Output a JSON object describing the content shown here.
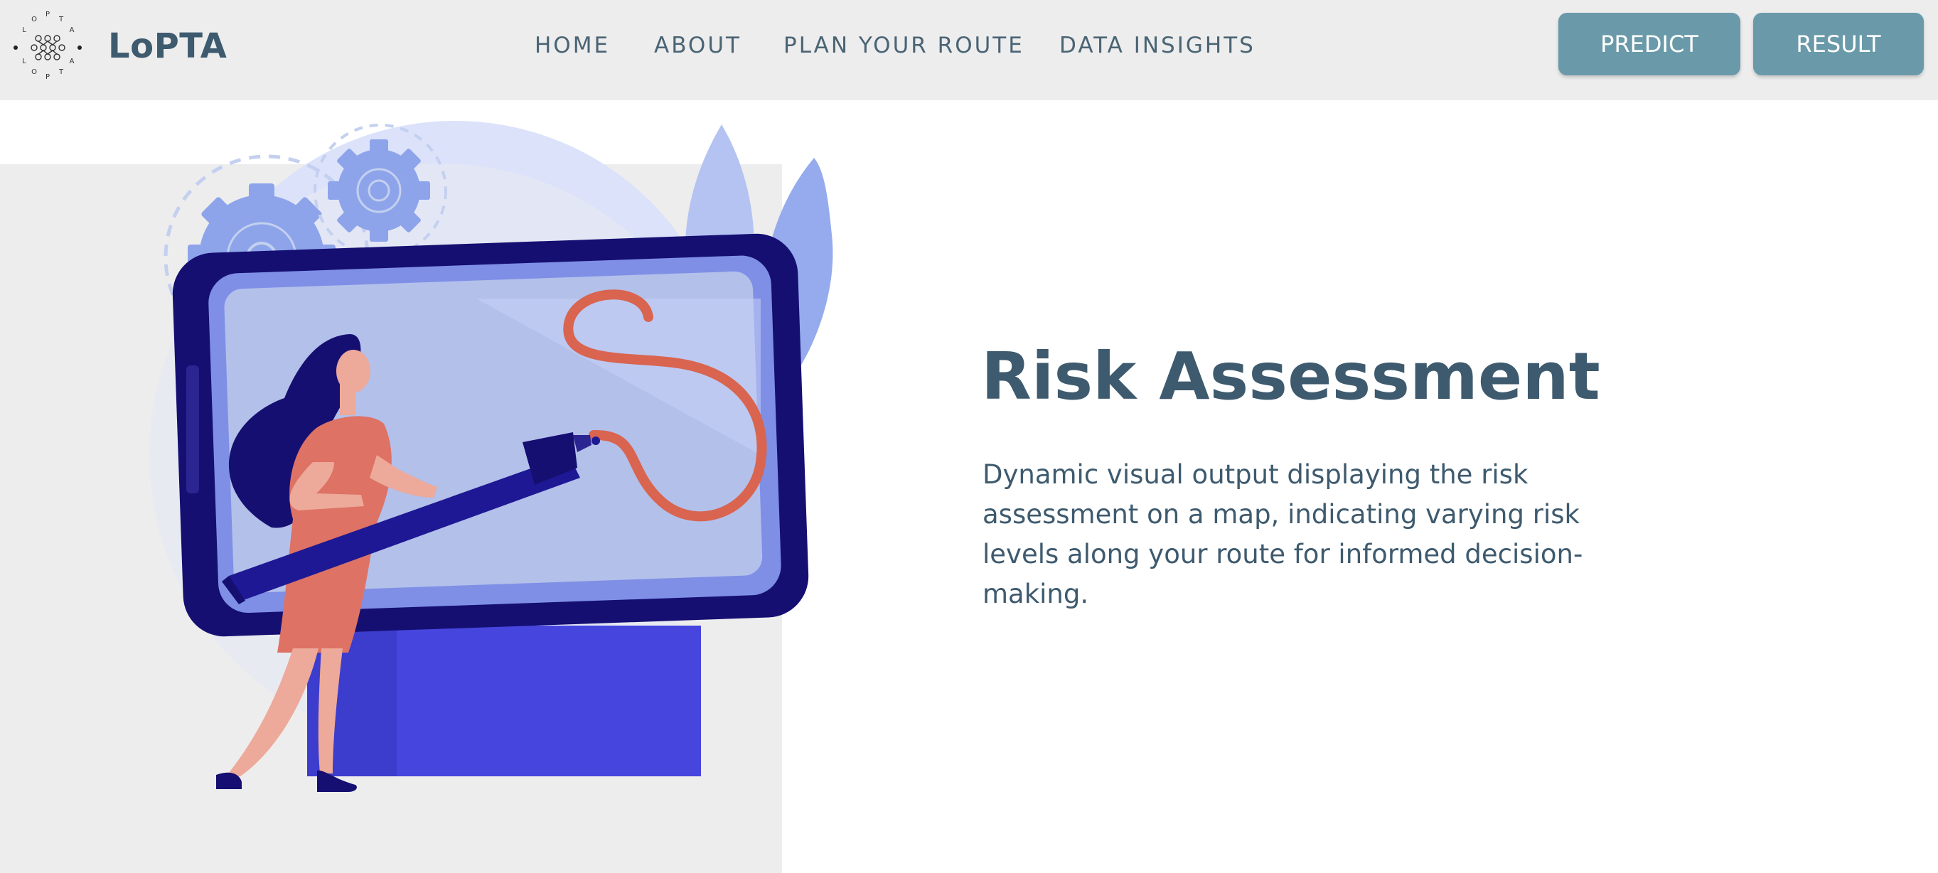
{
  "brand": {
    "name": "LoPTA",
    "logo_icon": "circular-network-logo",
    "logo_ring_letters": "LOPTA LOPTA"
  },
  "nav": {
    "links": [
      "HOME",
      "ABOUT",
      "PLAN YOUR ROUTE",
      "DATA INSIGHTS"
    ],
    "buttons": [
      "PREDICT",
      "RESULT"
    ]
  },
  "hero": {
    "title": "Risk Assessment",
    "description": "Dynamic visual output displaying the risk assessment on a map, indicating varying risk levels along your route for informed decision-making.",
    "illustration": "woman-drawing-route-on-screen-illustration"
  },
  "colors": {
    "navbar_bg": "#ededed",
    "brand_text": "#3e5a6e",
    "nav_link": "#4a6474",
    "button_bg": "#6a9aa9",
    "button_text": "#ffffff",
    "screen_frame": "#150f72",
    "screen_stand": "#4646de",
    "route_line": "#d9644f"
  }
}
